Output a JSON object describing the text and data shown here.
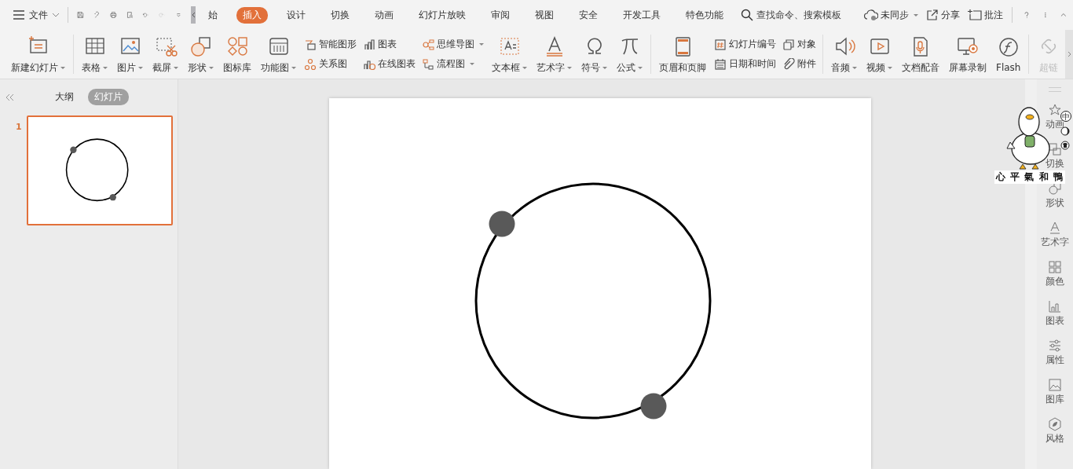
{
  "menu": {
    "label": "文件"
  },
  "tabs": [
    {
      "label": "始",
      "selected": false
    },
    {
      "label": "插入",
      "selected": true
    },
    {
      "label": "设计",
      "selected": false
    },
    {
      "label": "切换",
      "selected": false
    },
    {
      "label": "动画",
      "selected": false
    },
    {
      "label": "幻灯片放映",
      "selected": false
    },
    {
      "label": "审阅",
      "selected": false
    },
    {
      "label": "视图",
      "selected": false
    },
    {
      "label": "安全",
      "selected": false
    },
    {
      "label": "开发工具",
      "selected": false
    },
    {
      "label": "特色功能",
      "selected": false
    }
  ],
  "search": {
    "placeholder": "查找命令、搜索模板"
  },
  "actions": [
    {
      "label": "未同步",
      "dropdown": true
    },
    {
      "label": "分享",
      "dropdown": false
    },
    {
      "label": "批注",
      "dropdown": false
    }
  ],
  "ribbon": [
    {
      "kind": "large",
      "label": "新建幻灯片",
      "dropdown": true,
      "group_end": true
    },
    {
      "kind": "large",
      "label": "表格",
      "dropdown": true
    },
    {
      "kind": "large",
      "label": "图片",
      "dropdown": true
    },
    {
      "kind": "large",
      "label": "截屏",
      "dropdown": true
    },
    {
      "kind": "large",
      "label": "形状",
      "dropdown": true
    },
    {
      "kind": "large",
      "label": "图标库",
      "dropdown": false
    },
    {
      "kind": "large",
      "label": "功能图",
      "dropdown": true
    },
    {
      "kind": "stack",
      "items": [
        {
          "label": "智能图形",
          "dropdown": false
        },
        {
          "label": "关系图",
          "dropdown": false
        }
      ]
    },
    {
      "kind": "stack",
      "items": [
        {
          "label": "图表",
          "dropdown": false
        },
        {
          "label": "在线图表",
          "dropdown": false
        }
      ]
    },
    {
      "kind": "stack",
      "items": [
        {
          "label": "思维导图",
          "dropdown": true
        },
        {
          "label": "流程图",
          "dropdown": true
        }
      ]
    },
    {
      "kind": "large",
      "label": "文本框",
      "dropdown": true
    },
    {
      "kind": "large",
      "label": "艺术字",
      "dropdown": true
    },
    {
      "kind": "large",
      "label": "符号",
      "dropdown": true
    },
    {
      "kind": "large",
      "label": "公式",
      "dropdown": true,
      "group_end": true
    },
    {
      "kind": "large",
      "label": "页眉和页脚",
      "dropdown": false
    },
    {
      "kind": "stack",
      "items": [
        {
          "label": "幻灯片编号",
          "dropdown": false
        },
        {
          "label": "日期和时间",
          "dropdown": false
        }
      ]
    },
    {
      "kind": "stack",
      "items": [
        {
          "label": "对象",
          "dropdown": false
        },
        {
          "label": "附件",
          "dropdown": false
        }
      ],
      "group_end": true
    },
    {
      "kind": "large",
      "label": "音频",
      "dropdown": true
    },
    {
      "kind": "large",
      "label": "视频",
      "dropdown": true
    },
    {
      "kind": "large",
      "label": "文档配音",
      "dropdown": false
    },
    {
      "kind": "large",
      "label": "屏幕录制",
      "dropdown": false
    },
    {
      "kind": "large",
      "label": "Flash",
      "dropdown": false,
      "group_end": true
    },
    {
      "kind": "large",
      "label": "超链",
      "dropdown": false,
      "disabled": true
    }
  ],
  "panel_tabs": [
    {
      "label": "大纲",
      "selected": false
    },
    {
      "label": "幻灯片",
      "selected": true
    }
  ],
  "slides": [
    {
      "number": "1",
      "selected": true
    }
  ],
  "side_panel": [
    {
      "label": "动画"
    },
    {
      "label": "切换"
    },
    {
      "label": "形状"
    },
    {
      "label": "艺术字"
    },
    {
      "label": "颜色"
    },
    {
      "label": "图表"
    },
    {
      "label": "属性"
    },
    {
      "label": "图库"
    },
    {
      "label": "风格"
    }
  ],
  "sticker": {
    "caption": "心 平 氣 和 鴨",
    "ime_indicator": "中"
  }
}
